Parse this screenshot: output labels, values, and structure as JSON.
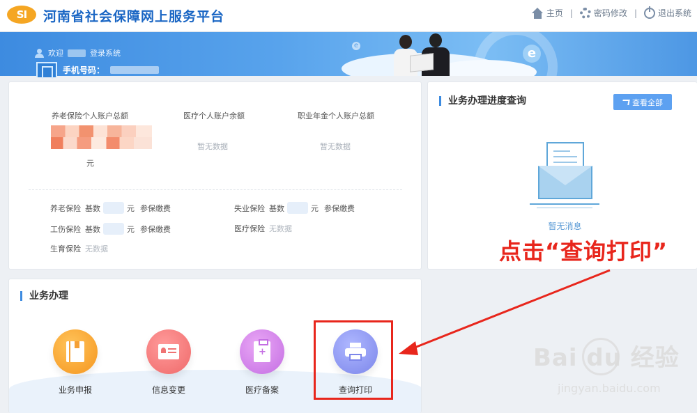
{
  "header": {
    "logo_text": "SI",
    "site_title": "河南省社会保障网上服务平台",
    "links": [
      {
        "label": "主页",
        "icon": "home-icon"
      },
      {
        "label": "密码修改",
        "icon": "gear-icon"
      },
      {
        "label": "退出系统",
        "icon": "power-icon"
      }
    ],
    "separator": "|"
  },
  "banner": {
    "welcome_prefix": "欢迎",
    "welcome_suffix": "登录系统",
    "phone_label": "手机号码："
  },
  "account": {
    "columns": [
      {
        "title": "养老保险个人账户总额",
        "value": "元"
      },
      {
        "title": "医疗个人账户余额",
        "value": "暂无数据"
      },
      {
        "title": "职业年金个人账户总额",
        "value": "暂无数据"
      }
    ],
    "insurance": [
      {
        "name": "养老保险",
        "base_label": "基数",
        "unit": "元",
        "suffix": "参保缴费"
      },
      {
        "name": "失业保险",
        "base_label": "基数",
        "unit": "元",
        "suffix": "参保缴费"
      },
      {
        "name": "工伤保险",
        "base_label": "基数",
        "unit": "元",
        "suffix": "参保缴费"
      },
      {
        "name": "医疗保险",
        "status": "无数据"
      },
      {
        "name": "生育保险",
        "status": "无数据"
      }
    ]
  },
  "progress": {
    "title": "业务办理进度查询",
    "view_all_label": "查看全部",
    "empty_text": "暂无消息"
  },
  "business": {
    "title": "业务办理",
    "items": [
      {
        "label": "业务申报",
        "icon": "book-icon",
        "color": "#f5961f"
      },
      {
        "label": "信息变更",
        "icon": "id-card-icon",
        "color": "#ef6a6a"
      },
      {
        "label": "医疗备案",
        "icon": "clipboard-plus-icon",
        "color": "#c46ee3"
      },
      {
        "label": "查询打印",
        "icon": "printer-icon",
        "color": "#7c86ea"
      }
    ]
  },
  "annotation": {
    "text": "点击“查询打印”",
    "color": "#e8261c"
  },
  "watermark": {
    "brand": "Bai  du 经验",
    "url": "jingyan.baidu.com"
  },
  "colors": {
    "brand_blue": "#1a66c4",
    "accent": "#3d8be0",
    "button": "#5da1f1"
  }
}
